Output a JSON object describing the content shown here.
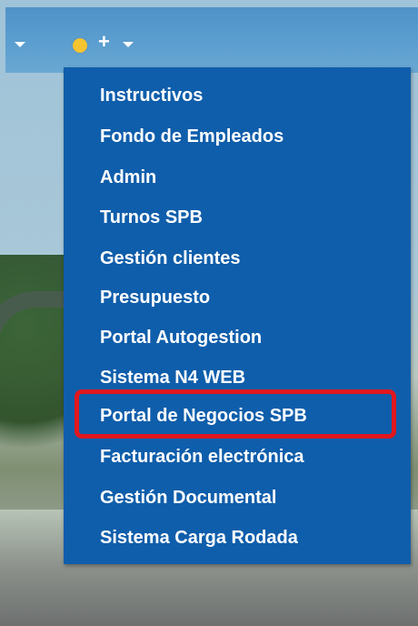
{
  "topbar": {
    "status_color": "#f5c430",
    "plus_label": "+"
  },
  "menu": {
    "background": "#0f5eab",
    "items": [
      {
        "label": "Instructivos"
      },
      {
        "label": "Fondo de Empleados"
      },
      {
        "label": "Admin"
      },
      {
        "label": "Turnos SPB"
      },
      {
        "label": "Gestión clientes"
      },
      {
        "label": "Presupuesto"
      },
      {
        "label": "Portal Autogestion"
      },
      {
        "label": "Sistema N4 WEB"
      },
      {
        "label": "Portal de Negocios SPB",
        "highlighted": true
      },
      {
        "label": "Facturación electrónica"
      },
      {
        "label": "Gestión Documental"
      },
      {
        "label": "Sistema Carga Rodada"
      }
    ]
  },
  "highlight": {
    "color": "#e0181f"
  }
}
